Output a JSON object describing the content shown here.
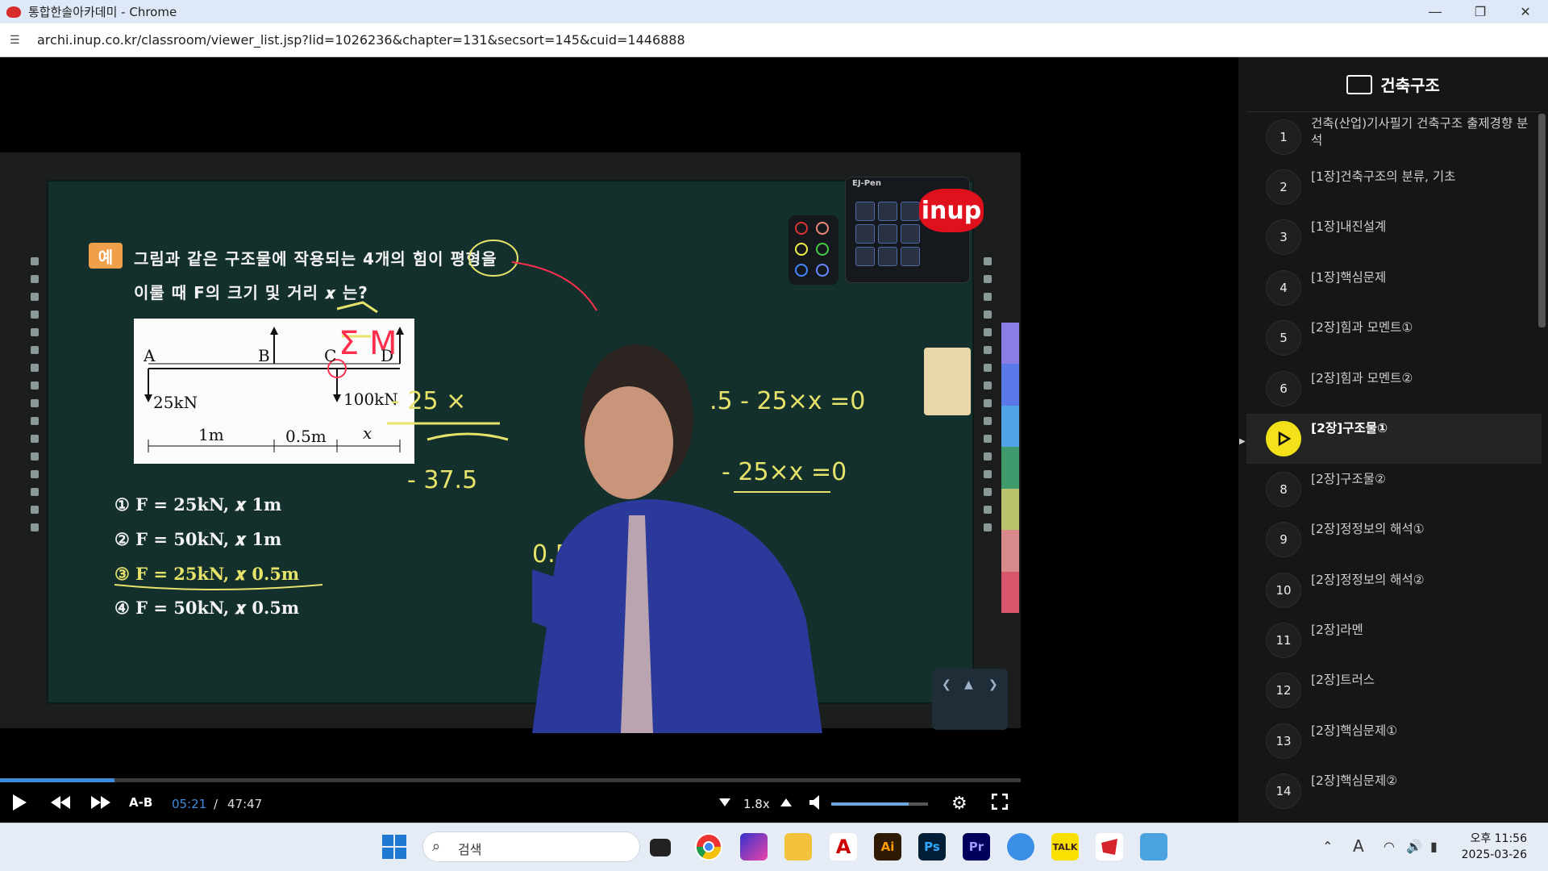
{
  "window": {
    "title": "통합한솔아카데미 - Chrome",
    "url": "archi.inup.co.kr/classroom/viewer_list.jsp?lid=1026236&chapter=131&secsort=145&cuid=1446888"
  },
  "lecture": {
    "badge": "예",
    "question_line1": "그림과 같은 구조물에 작용되는 4개의 힘이 평형을",
    "question_line2": "이룰 때 F의 크기 및 거리 𝒙 는?",
    "figure": {
      "points": [
        "A",
        "B",
        "C",
        "D"
      ],
      "load_left": "25kN",
      "load_mid": "100kN",
      "dims": [
        "1m",
        "0.5m",
        "x"
      ]
    },
    "options": [
      "① F = 25kN,  𝒙 1m",
      "② F = 50kN,  𝒙 1m",
      "③ F = 25kN,  𝒙 0.5m",
      "④ F = 50kN,  𝒙 0.5m"
    ],
    "pen_palette_title": "EJ-Pen",
    "logo": "inup"
  },
  "player": {
    "ab_label": "A-B",
    "current_time": "05:21",
    "separator": "/",
    "total_time": "47:47",
    "speed": "1.8x",
    "progress_fraction": 0.112,
    "volume_fraction": 0.8
  },
  "playlist": {
    "title": "건축구조",
    "items": [
      {
        "num": "1",
        "label": "건축(산업)기사필기 건축구조 출제경향 분석"
      },
      {
        "num": "2",
        "label": "[1장]건축구조의 분류, 기초"
      },
      {
        "num": "3",
        "label": "[1장]내진설계"
      },
      {
        "num": "4",
        "label": "[1장]핵심문제"
      },
      {
        "num": "5",
        "label": "[2장]힘과 모멘트①"
      },
      {
        "num": "6",
        "label": "[2장]힘과 모멘트②"
      },
      {
        "num": "",
        "label": "[2장]구조물①",
        "active": true
      },
      {
        "num": "8",
        "label": "[2장]구조물②"
      },
      {
        "num": "9",
        "label": "[2장]정정보의 해석①"
      },
      {
        "num": "10",
        "label": "[2장]정정보의 해석②"
      },
      {
        "num": "11",
        "label": "[2장]라멘"
      },
      {
        "num": "12",
        "label": "[2장]트러스"
      },
      {
        "num": "13",
        "label": "[2장]핵심문제①"
      },
      {
        "num": "14",
        "label": "[2장]핵심문제②"
      }
    ]
  },
  "taskbar": {
    "search_placeholder": "검색",
    "time": "오후 11:56",
    "date": "2025-03-26",
    "ime": "A"
  }
}
